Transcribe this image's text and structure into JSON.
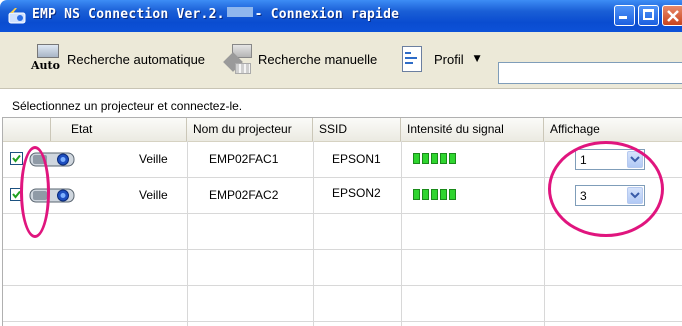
{
  "window": {
    "title_prefix": "EMP NS Connection Ver.2.",
    "title_suffix": "- Connexion rapide",
    "minimize_icon": "minimize-icon",
    "maximize_icon": "maximize-icon",
    "close_icon": "close-icon"
  },
  "toolbar": {
    "auto_icon_text": "Auto",
    "auto_search_label": "Recherche automatique",
    "manual_search_label": "Recherche manuelle",
    "profile_label": "Profil",
    "profile_arrow": "▼",
    "profile_value": ""
  },
  "status_message": "Sélectionnez un projecteur et connectez-le.",
  "table": {
    "headers": [
      "",
      "Etat",
      "Nom du projecteur",
      "SSID",
      "Intensité du signal",
      "Affichage"
    ],
    "rows": [
      {
        "checked": true,
        "state": "Veille",
        "projector_name": "EMP02FAC1",
        "ssid": "EPSON1",
        "signal_bars": 5,
        "display": "1"
      },
      {
        "checked": true,
        "state": "Veille",
        "projector_name": "EMP02FAC2",
        "ssid": "EPSON2",
        "signal_bars": 5,
        "display": "3"
      }
    ],
    "empty_rows": 3
  },
  "colors": {
    "titlebar": "#0a4cd0",
    "highlight_ellipse": "#e0157e",
    "signal": "#2fd52f"
  }
}
